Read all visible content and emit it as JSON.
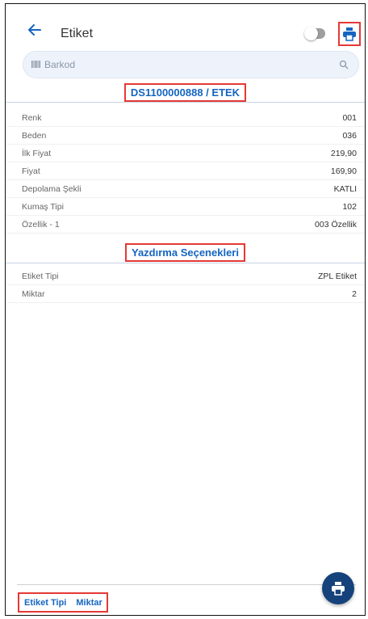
{
  "header": {
    "title": "Etiket",
    "back_icon": "arrow-left-icon",
    "toggle_state": "off",
    "print_icon": "printer-icon"
  },
  "search": {
    "placeholder": "Barkod",
    "barcode_icon": "barcode-icon",
    "search_icon": "magnifier-icon"
  },
  "product": {
    "title": "DS1100000888 / ETEK",
    "rows": [
      {
        "label": "Renk",
        "value": "001"
      },
      {
        "label": "Beden",
        "value": "036"
      },
      {
        "label": "İlk Fiyat",
        "value": "219,90"
      },
      {
        "label": "Fiyat",
        "value": "169,90"
      },
      {
        "label": "Depolama Şekli",
        "value": "KATLI"
      },
      {
        "label": "Kumaş Tipi",
        "value": "102"
      },
      {
        "label": "Özellik - 1",
        "value": "003 Özellik"
      }
    ]
  },
  "print_options": {
    "title": "Yazdırma Seçenekleri",
    "rows": [
      {
        "label": "Etiket Tipi",
        "value": "ZPL Etiket"
      },
      {
        "label": "Miktar",
        "value": "2"
      }
    ]
  },
  "bottom": {
    "etiket_tipi": "Etiket Tipi",
    "miktar": "Miktar"
  },
  "fab": {
    "icon": "printer-icon"
  },
  "colors": {
    "accent": "#1565c0",
    "fab": "#15427a",
    "highlight": "#e53935"
  }
}
